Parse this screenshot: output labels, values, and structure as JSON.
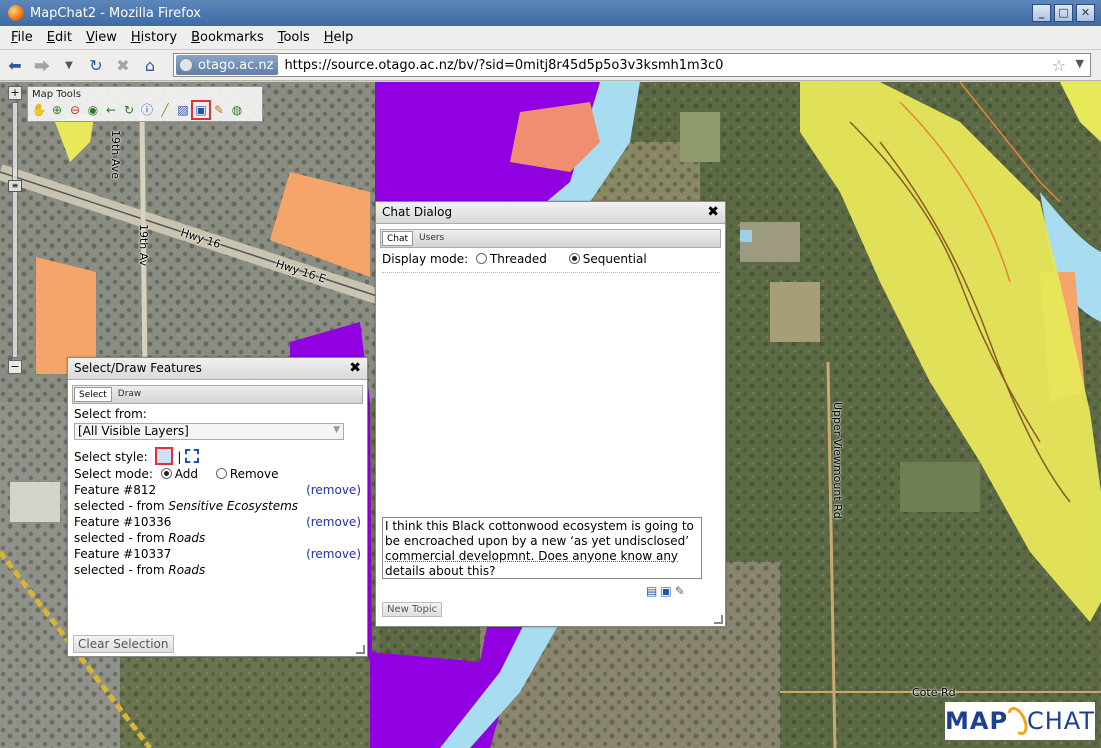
{
  "window": {
    "title": "MapChat2 - Mozilla Firefox",
    "controls": [
      "_",
      "□",
      "✕"
    ]
  },
  "menu": [
    {
      "key": "F",
      "rest": "ile"
    },
    {
      "key": "E",
      "rest": "dit"
    },
    {
      "key": "V",
      "rest": "iew"
    },
    {
      "key": "H",
      "rest": "istory"
    },
    {
      "key": "B",
      "rest": "ookmarks"
    },
    {
      "key": "T",
      "rest": "ools"
    },
    {
      "key": "H",
      "rest": "elp"
    }
  ],
  "nav": {
    "site_identity": "otago.ac.nz",
    "url": "https://source.otago.ac.nz/bv/?sid=0mitj8r45d5p5o3v3ksmh1m3c0"
  },
  "map": {
    "labels": [
      "19th Ave",
      "19th Av",
      "Hwy 16",
      "Hwy 16 E",
      "Upper Viewmount Rd",
      "Cote Rd"
    ],
    "tools_title": "Map Tools",
    "tool_icons": [
      "pan-icon",
      "zoom-in-icon",
      "zoom-out-icon",
      "zoom-extent-icon",
      "back-icon",
      "refresh-icon",
      "info-icon",
      "measure-icon",
      "zoom-box-icon",
      "select-icon",
      "draw-icon",
      "help-icon"
    ],
    "zoom_in": "+",
    "zoom_out": "−"
  },
  "select_dialog": {
    "title": "Select/Draw Features",
    "tabs": [
      "Select",
      "Draw"
    ],
    "select_from_label": "Select from:",
    "select_from_value": "[All Visible Layers]",
    "select_style_label": "Select style:",
    "select_mode_label": "Select mode:",
    "mode_add": "Add",
    "mode_remove": "Remove",
    "features": [
      {
        "name": "Feature #812",
        "source_prefix": "selected - from ",
        "source": "Sensitive Ecosystems",
        "action": "(remove)"
      },
      {
        "name": "Feature #10336",
        "source_prefix": "selected - from ",
        "source": "Roads",
        "action": "(remove)"
      },
      {
        "name": "Feature #10337",
        "source_prefix": "selected - from ",
        "source": "Roads",
        "action": "(remove)"
      }
    ],
    "clear_button": "Clear Selection"
  },
  "chat_dialog": {
    "title": "Chat Dialog",
    "tabs": [
      "Chat",
      "Users"
    ],
    "display_mode_label": "Display mode:",
    "mode_threaded": "Threaded",
    "mode_sequential": "Sequential",
    "message_lines": [
      "I think this Black cottonwood ecosystem is going to",
      "be encroached upon by a new ‘as yet undisclosed’",
      "commercial developmnt.  Does anyone know any",
      "details about this?"
    ],
    "new_topic_button": "New Topic"
  },
  "logo": {
    "left": "MAP",
    "right": "CHAT"
  }
}
